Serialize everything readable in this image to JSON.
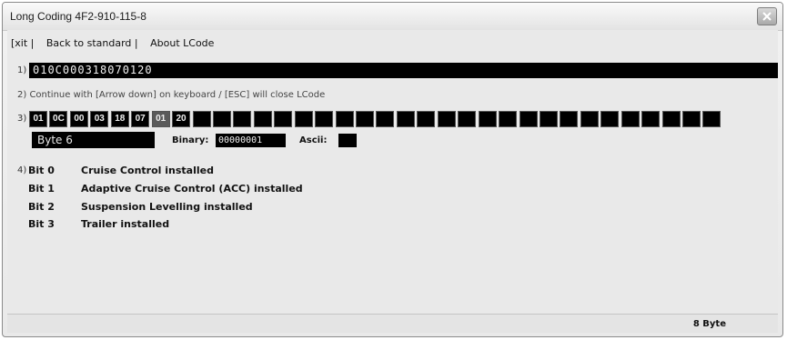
{
  "window": {
    "title": "Long Coding  4F2-910-115-8"
  },
  "menu": {
    "items": [
      {
        "label": "Exit",
        "display": "[xit |"
      },
      {
        "label": "Back to standard",
        "display": "Back to standard |"
      },
      {
        "label": "About LCode",
        "display": "About LCode"
      }
    ]
  },
  "rows": {
    "row1_label": "1)",
    "coding_value": "010C000318070120",
    "row2_text": "2) Continue with [Arrow down] on keyboard / [ESC] will close LCode",
    "row3_label": "3)",
    "row4_label": "4)"
  },
  "bytes": {
    "values": [
      "01",
      "0C",
      "00",
      "03",
      "18",
      "07",
      "01",
      "20",
      "",
      "",
      "",
      "",
      "",
      "",
      "",
      "",
      "",
      "",
      "",
      "",
      "",
      "",
      "",
      "",
      "",
      "",
      "",
      "",
      "",
      "",
      "",
      "",
      "",
      ""
    ],
    "selected_index": 6
  },
  "byte_detail": {
    "byte_label": "Byte 6",
    "binary_label": "Binary:",
    "binary_value": "00000001",
    "ascii_label": "Ascii:",
    "ascii_value": ""
  },
  "bits": [
    {
      "name": "Bit 0",
      "description": "Cruise Control installed"
    },
    {
      "name": "Bit 1",
      "description": "Adaptive Cruise Control (ACC) installed"
    },
    {
      "name": "Bit 2",
      "description": "Suspension Levelling installed"
    },
    {
      "name": "Bit 3",
      "description": "Trailer installed"
    }
  ],
  "status": {
    "byte_count": "8 Byte"
  },
  "icons": {
    "close": "close-icon"
  }
}
